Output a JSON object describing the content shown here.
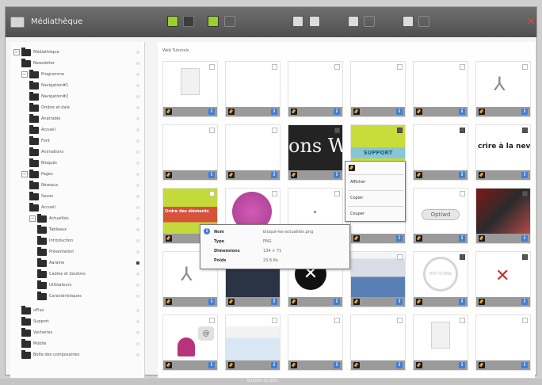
{
  "window": {
    "title": "Médiathèque"
  },
  "toolbar": {
    "buttons": [
      {
        "name": "grid-view-icon",
        "state": "on"
      },
      {
        "name": "list-view-icon",
        "state": "off"
      },
      {
        "name": "upload-icon",
        "state": "on"
      },
      {
        "name": "slideshow-icon",
        "state": "dim"
      },
      {
        "name": "settings-icon",
        "state": "light"
      },
      {
        "name": "delete-icon",
        "state": "light"
      },
      {
        "name": "move-icon",
        "state": "light"
      },
      {
        "name": "move-disabled-icon",
        "state": "ghost"
      },
      {
        "name": "copy-icon",
        "state": "light"
      },
      {
        "name": "copy-disabled-icon",
        "state": "ghost"
      }
    ],
    "close_glyph": "✕"
  },
  "sidebar": {
    "items": [
      {
        "label": "Médiathèque",
        "toggle": "−",
        "indent": 0
      },
      {
        "label": "Newsletter",
        "toggle": "",
        "indent": 1
      },
      {
        "label": "Programme",
        "toggle": "−",
        "indent": 1
      },
      {
        "label": "Navigation#1",
        "toggle": "",
        "indent": 2
      },
      {
        "label": "Navigation#2",
        "toggle": "",
        "indent": 2
      },
      {
        "label": "Ombre et dale",
        "toggle": "",
        "indent": 2
      },
      {
        "label": "Anatrable",
        "toggle": "",
        "indent": 2
      },
      {
        "label": "Accueil",
        "toggle": "",
        "indent": 2
      },
      {
        "label": "Font",
        "toggle": "",
        "indent": 2
      },
      {
        "label": "Animations",
        "toggle": "",
        "indent": 2
      },
      {
        "label": "Bloqués",
        "toggle": "",
        "indent": 2
      },
      {
        "label": "Pages",
        "toggle": "−",
        "indent": 1
      },
      {
        "label": "Réseaux",
        "toggle": "",
        "indent": 2
      },
      {
        "label": "Savon",
        "toggle": "",
        "indent": 2
      },
      {
        "label": "Accueil",
        "toggle": "",
        "indent": 2
      },
      {
        "label": "Actualités",
        "toggle": "−",
        "indent": 2
      },
      {
        "label": "Tableaux",
        "toggle": "",
        "indent": 3
      },
      {
        "label": "Introduction",
        "toggle": "",
        "indent": 3
      },
      {
        "label": "Présentation",
        "toggle": "",
        "indent": 3
      },
      {
        "label": "Aaraine",
        "toggle": "",
        "indent": 3
      },
      {
        "label": "Cadres et boutons",
        "toggle": "",
        "indent": 3
      },
      {
        "label": "Utilisateurs",
        "toggle": "",
        "indent": 3
      },
      {
        "label": "Caractéristiques",
        "toggle": "",
        "indent": 3
      },
      {
        "label": "uPlaz",
        "toggle": "",
        "indent": 1
      },
      {
        "label": "Support",
        "toggle": "",
        "indent": 1
      },
      {
        "label": "Vacheries",
        "toggle": "",
        "indent": 1
      },
      {
        "label": "Mobile",
        "toggle": "",
        "indent": 1
      },
      {
        "label": "Boîte des composantes",
        "toggle": "",
        "indent": 1
      }
    ]
  },
  "main": {
    "breadcrumb": "Web Tutoriels",
    "tiles": [
      {
        "kind": "doc"
      },
      {
        "kind": "blank"
      },
      {
        "kind": "blank"
      },
      {
        "kind": "blank"
      },
      {
        "kind": "blank"
      },
      {
        "kind": "pdf"
      },
      {
        "kind": "blank"
      },
      {
        "kind": "blank"
      },
      {
        "kind": "banner",
        "text": "ons Wy",
        "bg": "#232323"
      },
      {
        "kind": "support",
        "text": "SUPPORT"
      },
      {
        "kind": "blank"
      },
      {
        "kind": "banner-dark",
        "text": "crire à la nev"
      },
      {
        "kind": "green",
        "text": "Ordre des éléments"
      },
      {
        "kind": "pink"
      },
      {
        "kind": "dot"
      },
      {
        "kind": "blank"
      },
      {
        "kind": "optiwd",
        "text": "Optiwd"
      },
      {
        "kind": "collage"
      },
      {
        "kind": "pdf"
      },
      {
        "kind": "dark-photo"
      },
      {
        "kind": "xclose",
        "text": "✕"
      },
      {
        "kind": "screens"
      },
      {
        "kind": "stamp",
        "text": "HOT ICONS"
      },
      {
        "kind": "tools"
      },
      {
        "kind": "person"
      },
      {
        "kind": "infographic"
      },
      {
        "kind": "blank"
      },
      {
        "kind": "blank"
      },
      {
        "kind": "doc"
      },
      {
        "kind": "blank"
      }
    ]
  },
  "context_menu": {
    "items": [
      "Afficher",
      "Copier",
      "Couper"
    ]
  },
  "tooltip": {
    "rows": [
      {
        "key": "Nom",
        "value": "bloqué-les-actualités.png"
      },
      {
        "key": "Type",
        "value": "PNG"
      },
      {
        "key": "Dimensions",
        "value": "134 × 71"
      },
      {
        "key": "Poids",
        "value": "23.6 Ko"
      }
    ]
  },
  "footer": {
    "text": "Bulletin ou Info"
  },
  "colors": {
    "accent": "#9ad02c",
    "info": "#3f7fd9",
    "close": "#e0483c"
  }
}
